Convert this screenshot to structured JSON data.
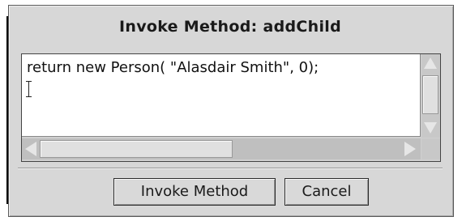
{
  "dialog": {
    "title": "Invoke Method: addChild"
  },
  "editor": {
    "text": "return new Person( \"Alasdair Smith\", 0);"
  },
  "buttons": {
    "invoke_label": "Invoke Method",
    "cancel_label": "Cancel"
  },
  "icons": {
    "scroll_up": "triangle-up-icon",
    "scroll_down": "triangle-down-icon",
    "scroll_left": "triangle-left-icon",
    "scroll_right": "triangle-right-icon",
    "text_cursor": "ibeam-cursor-icon"
  }
}
